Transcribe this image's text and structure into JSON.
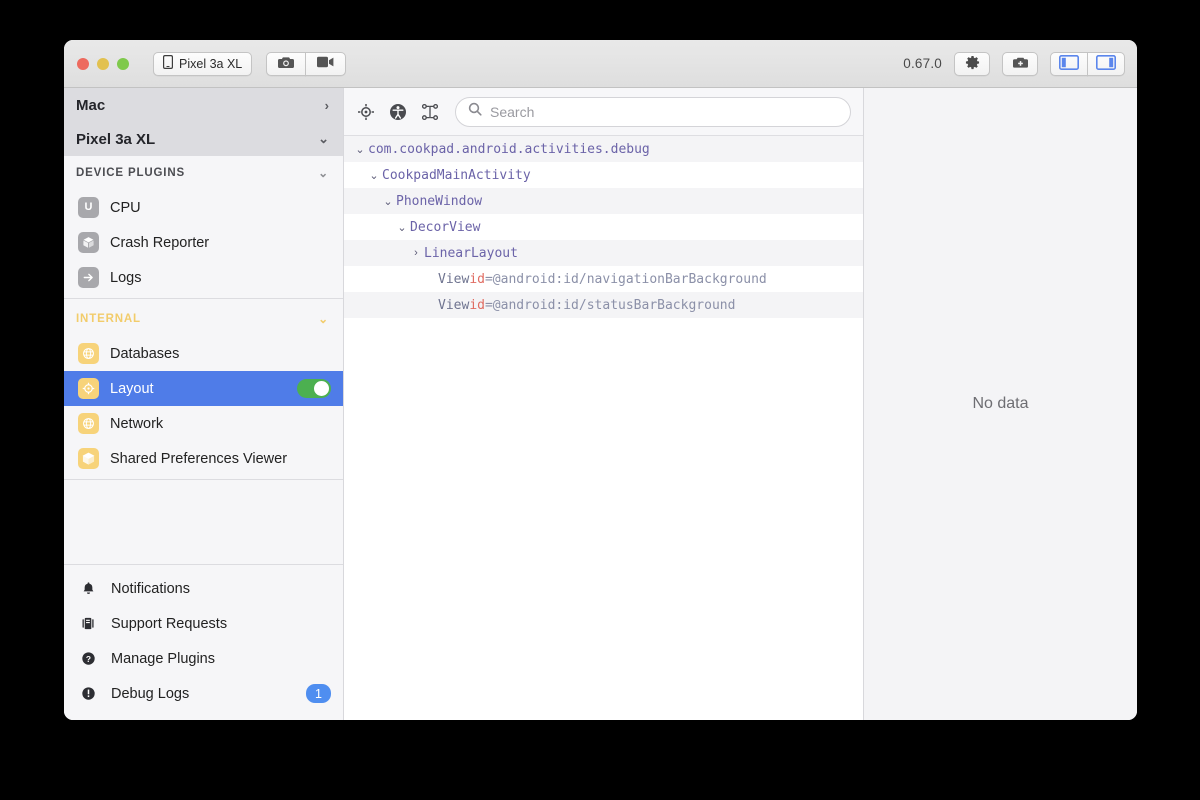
{
  "titlebar": {
    "window_controls": [
      "close",
      "minimize",
      "maximize"
    ],
    "device_button": {
      "label": "Pixel 3a XL",
      "icon": "phone-icon"
    },
    "screenshot_button": {
      "icon": "camera-icon",
      "label": ""
    },
    "record_button": {
      "icon": "video-camera-icon",
      "label": ""
    },
    "version": "0.67.0",
    "settings_button": {
      "icon": "gear-icon",
      "label": ""
    },
    "bug_report_button": {
      "icon": "camera-bug-icon",
      "label": ""
    },
    "left_panel_toggle": {
      "icon": "left-panel-icon",
      "label": ""
    },
    "right_panel_toggle": {
      "icon": "right-panel-icon",
      "label": ""
    }
  },
  "sidebar": {
    "host": {
      "label": "Mac",
      "chevron": "›"
    },
    "device": {
      "label": "Pixel 3a XL",
      "chevron": "⌄"
    },
    "sections": [
      {
        "title": "DEVICE PLUGINS",
        "chevron": "⌄",
        "title_color": "#4c4d52",
        "items": [
          {
            "label": "CPU",
            "icon": "cpu-icon",
            "icon_color": "#a8a8ac",
            "glyph": "U"
          },
          {
            "label": "Crash Reporter",
            "icon": "cube-icon",
            "icon_color": "#a8a8ac",
            "glyph": ""
          },
          {
            "label": "Logs",
            "icon": "arrow-right-icon",
            "icon_color": "#a8a8ac",
            "glyph": ""
          }
        ]
      },
      {
        "title": "INTERNAL",
        "chevron": "⌄",
        "title_color": "#f2cc6b",
        "items": [
          {
            "label": "Databases",
            "icon": "globe-icon",
            "icon_color": "#f7d37a",
            "glyph": ""
          },
          {
            "label": "Layout",
            "icon": "target-icon",
            "icon_color": "#f7d37a",
            "glyph": "",
            "selected": true,
            "toggle": "on"
          },
          {
            "label": "Network",
            "icon": "globe-icon",
            "icon_color": "#f7d37a",
            "glyph": ""
          },
          {
            "label": "Shared Preferences Viewer",
            "icon": "cube-icon",
            "icon_color": "#f7d37a",
            "glyph": ""
          }
        ]
      }
    ],
    "bottom_nav": [
      {
        "label": "Notifications",
        "icon": "bell-icon",
        "badge": ""
      },
      {
        "label": "Support Requests",
        "icon": "support-icon",
        "badge": ""
      },
      {
        "label": "Manage Plugins",
        "icon": "question-circle-icon",
        "badge": ""
      },
      {
        "label": "Debug Logs",
        "icon": "info-circle-icon",
        "badge": "1"
      }
    ]
  },
  "toolbar": {
    "target_button": {
      "icon": "target-icon",
      "label": ""
    },
    "accessibility_button": {
      "icon": "accessibility-icon",
      "label": ""
    },
    "tree_button": {
      "icon": "node-tree-icon",
      "label": ""
    },
    "search": {
      "placeholder": "Search",
      "value": "",
      "icon": "search-icon"
    }
  },
  "tree": {
    "rows": [
      {
        "indent": 0,
        "arrow": "⌄",
        "name": "com.cookpad.android.activities.debug",
        "attr_key": "",
        "attr_val": "",
        "style": "node"
      },
      {
        "indent": 1,
        "arrow": "⌄",
        "name": "CookpadMainActivity",
        "attr_key": "",
        "attr_val": "",
        "style": "node"
      },
      {
        "indent": 2,
        "arrow": "⌄",
        "name": "PhoneWindow",
        "attr_key": "",
        "attr_val": "",
        "style": "node"
      },
      {
        "indent": 3,
        "arrow": "⌄",
        "name": "DecorView",
        "attr_key": "",
        "attr_val": "",
        "style": "node"
      },
      {
        "indent": 4,
        "arrow": "›",
        "name": "LinearLayout",
        "attr_key": "",
        "attr_val": "",
        "style": "node"
      },
      {
        "indent": 5,
        "arrow": "",
        "name": "View ",
        "attr_key": "id",
        "attr_val": "=@android:id/navigationBarBackground",
        "style": "view"
      },
      {
        "indent": 5,
        "arrow": "",
        "name": "View ",
        "attr_key": "id",
        "attr_val": "=@android:id/statusBarBackground",
        "style": "view"
      }
    ]
  },
  "right_panel": {
    "empty_message": "No data"
  },
  "colors": {
    "selection": "#4f7ce8",
    "toggle_on": "#4cb050",
    "badge": "#4f8ef0",
    "internal_header": "#f2cc6b",
    "node_text": "#6b63a8",
    "attr_key": "#e06c62",
    "attr_val": "#8b90a8"
  }
}
